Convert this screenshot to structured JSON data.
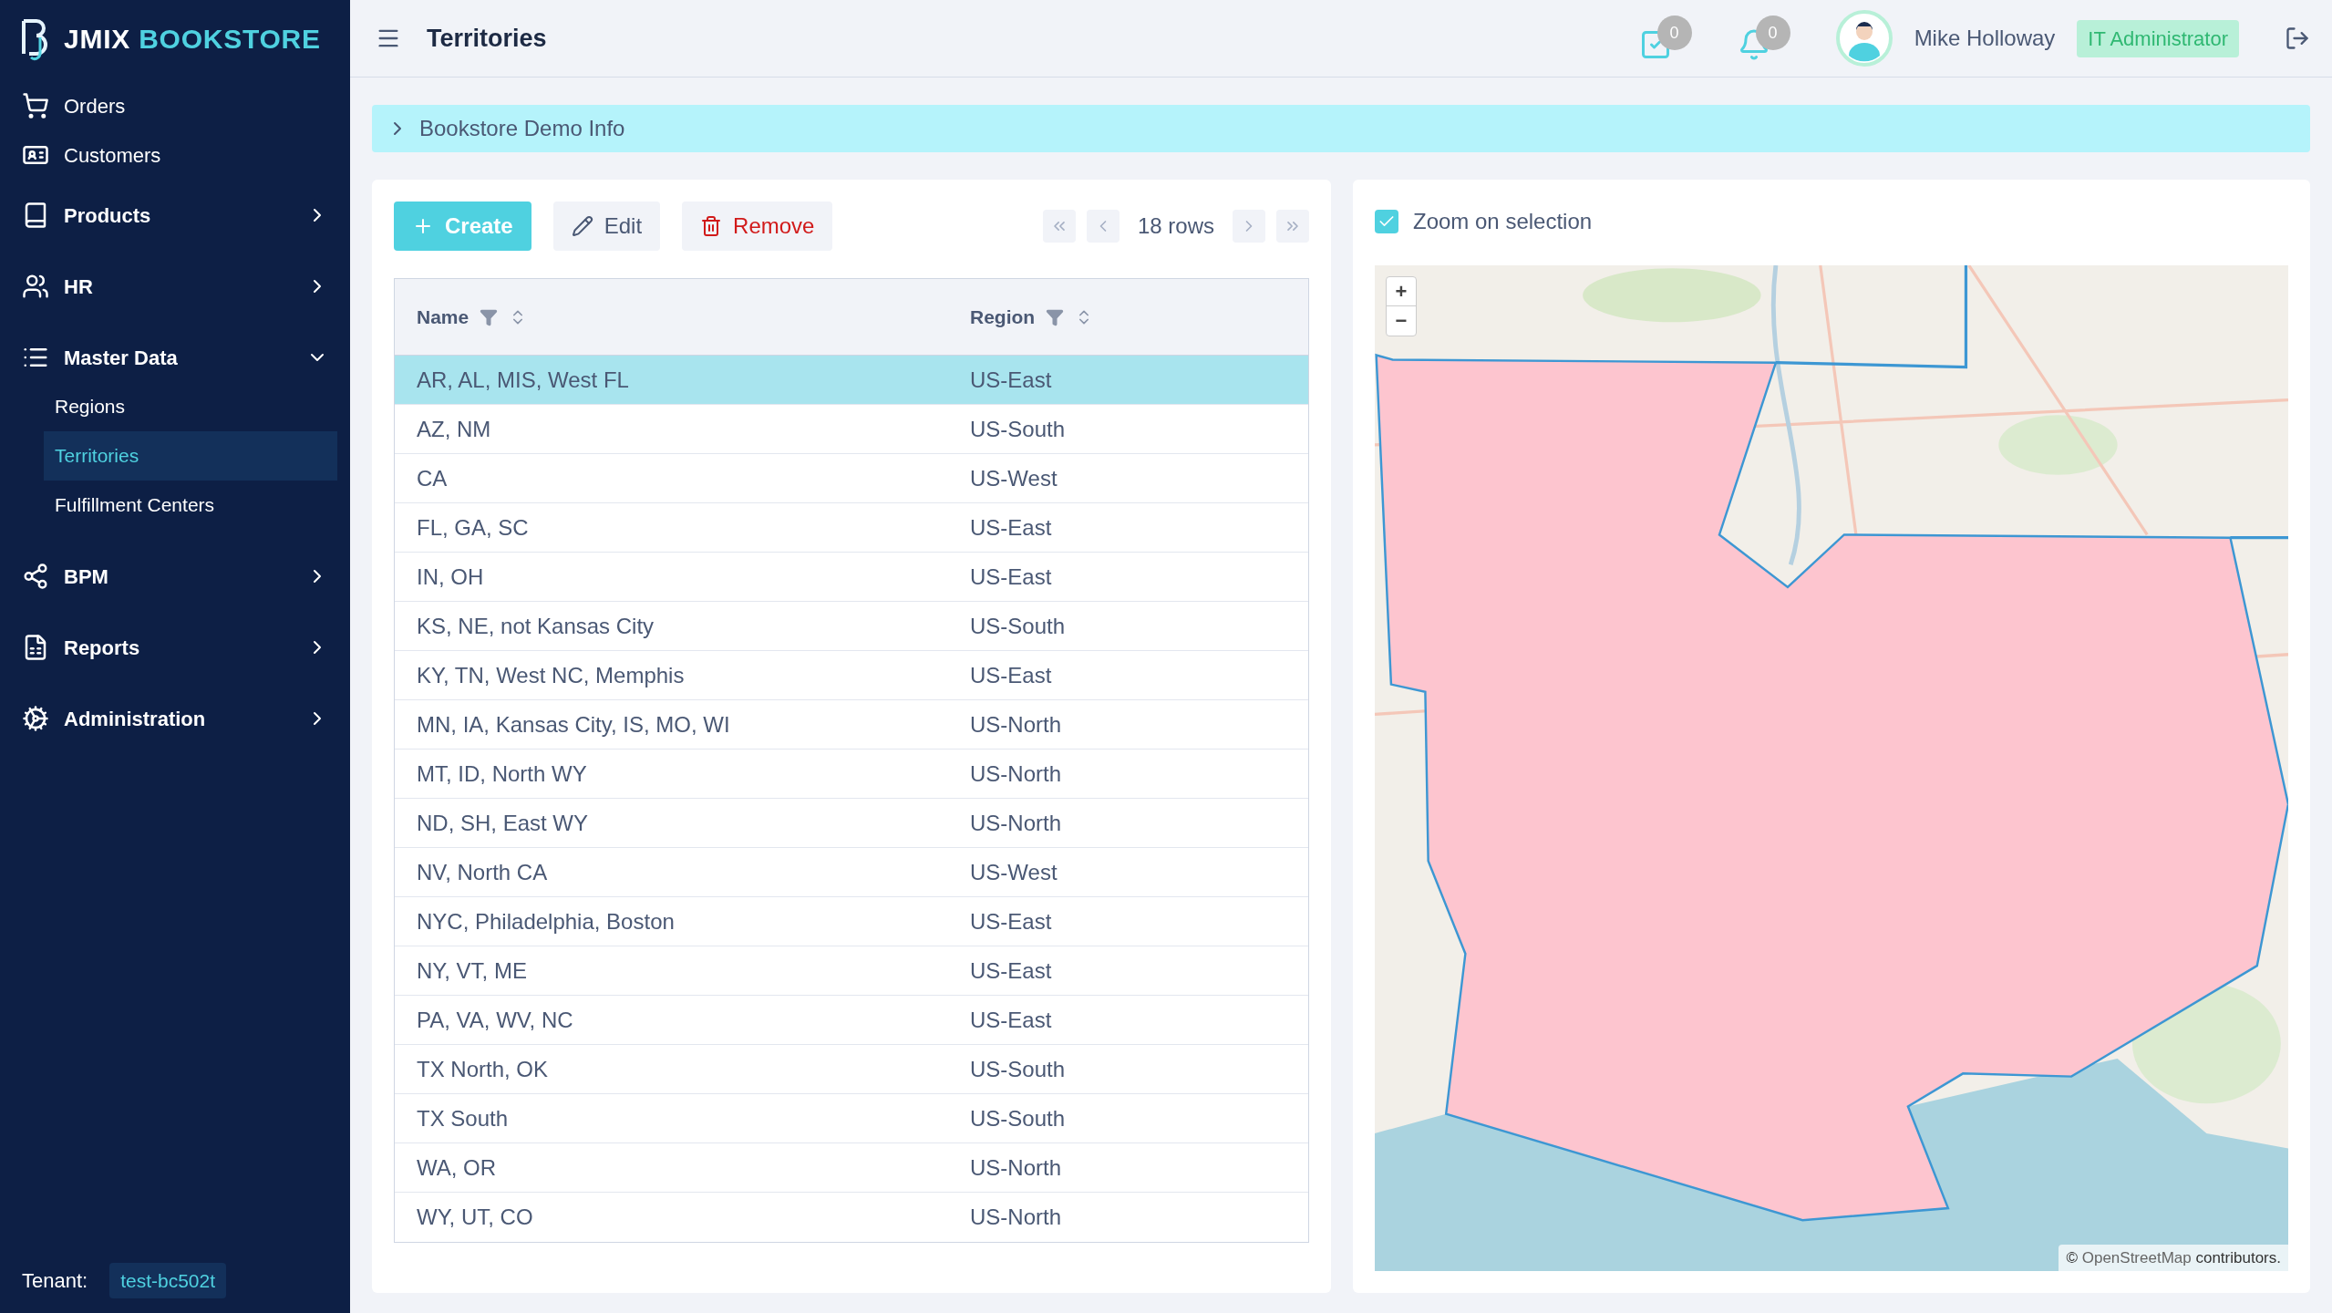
{
  "app": {
    "logo_word": "JMIX",
    "logo_name": "BOOKSTORE"
  },
  "sidebar": {
    "items": [
      {
        "label": "Orders",
        "kind": "link",
        "selected": false
      },
      {
        "label": "Customers",
        "kind": "link",
        "selected": false
      },
      {
        "label": "Products",
        "kind": "group",
        "expanded": false
      },
      {
        "label": "HR",
        "kind": "group",
        "expanded": false
      },
      {
        "label": "Master Data",
        "kind": "group",
        "expanded": true,
        "children": [
          {
            "label": "Regions",
            "selected": false
          },
          {
            "label": "Territories",
            "selected": true
          },
          {
            "label": "Fulfillment Centers",
            "selected": false
          }
        ]
      },
      {
        "label": "BPM",
        "kind": "group",
        "expanded": false
      },
      {
        "label": "Reports",
        "kind": "group",
        "expanded": false
      },
      {
        "label": "Administration",
        "kind": "group",
        "expanded": false
      }
    ],
    "tenant_label": "Tenant:",
    "tenant": "test-bc502t"
  },
  "header": {
    "title": "Territories",
    "tasks_count": "0",
    "notifications_count": "0",
    "user": "Mike Holloway",
    "role": "IT Administrator"
  },
  "info_panel": {
    "title": "Bookstore Demo Info",
    "expanded": false
  },
  "toolbar": {
    "create": "Create",
    "edit": "Edit",
    "remove": "Remove",
    "rows": "18 rows"
  },
  "table": {
    "columns": [
      "Name",
      "Region"
    ],
    "rows": [
      {
        "name": "AR, AL, MIS, West FL",
        "region": "US-East",
        "selected": true
      },
      {
        "name": "AZ, NM",
        "region": "US-South",
        "selected": false
      },
      {
        "name": "CA",
        "region": "US-West",
        "selected": false
      },
      {
        "name": "FL, GA, SC",
        "region": "US-East",
        "selected": false
      },
      {
        "name": "IN, OH",
        "region": "US-East",
        "selected": false
      },
      {
        "name": "KS, NE, not Kansas City",
        "region": "US-South",
        "selected": false
      },
      {
        "name": "KY, TN, West NC, Memphis",
        "region": "US-East",
        "selected": false
      },
      {
        "name": "MN, IA, Kansas City, IS, MO, WI",
        "region": "US-North",
        "selected": false
      },
      {
        "name": "MT, ID, North WY",
        "region": "US-North",
        "selected": false
      },
      {
        "name": "ND, SH, East WY",
        "region": "US-North",
        "selected": false
      },
      {
        "name": "NV, North CA",
        "region": "US-West",
        "selected": false
      },
      {
        "name": "NYC, Philadelphia, Boston",
        "region": "US-East",
        "selected": false
      },
      {
        "name": "NY, VT, ME",
        "region": "US-East",
        "selected": false
      },
      {
        "name": "PA, VA, WV, NC",
        "region": "US-East",
        "selected": false
      },
      {
        "name": "TX North, OK",
        "region": "US-South",
        "selected": false
      },
      {
        "name": "TX South",
        "region": "US-South",
        "selected": false
      },
      {
        "name": "WA, OR",
        "region": "US-North",
        "selected": false
      },
      {
        "name": "WY, UT, CO",
        "region": "US-North",
        "selected": false
      }
    ]
  },
  "map": {
    "zoom_on_selection": {
      "label": "Zoom on selection",
      "checked": true
    },
    "zoom_in": "+",
    "zoom_out": "−",
    "attribution_symbol": "©",
    "attribution_link": "OpenStreetMap",
    "attribution_text": "contributors."
  }
}
